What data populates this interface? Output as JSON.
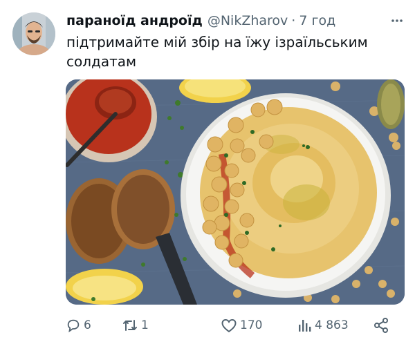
{
  "tweet": {
    "display_name": "параноїд андроїд",
    "handle": "@NikZharov",
    "separator": "·",
    "time": "7 год",
    "text": "підтримайте мій збір на їжу ізраїльським солдатам"
  },
  "media": {
    "description_icon": "photo-hummus",
    "colors": {
      "tablecloth": "#566a86",
      "plate": "#f3f3f1",
      "hummus": "#e7c36d",
      "paprika": "#b8321c"
    }
  },
  "actions": {
    "replies": "6",
    "reposts": "1",
    "likes": "170",
    "views": "4 863",
    "icons": [
      "reply-icon",
      "repost-icon",
      "like-icon",
      "views-icon",
      "share-icon"
    ]
  },
  "colors": {
    "text": "#0f1419",
    "muted": "#536471"
  }
}
